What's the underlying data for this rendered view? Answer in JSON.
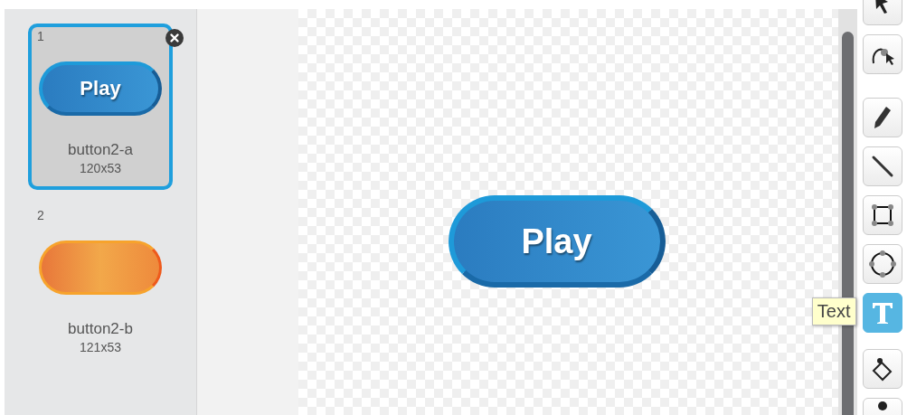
{
  "costumes": [
    {
      "number": "1",
      "name": "button2-a",
      "size": "120x53",
      "selected": true,
      "thumbnail": {
        "kind": "blue",
        "label": "Play"
      }
    },
    {
      "number": "2",
      "name": "button2-b",
      "size": "121x53",
      "selected": false,
      "thumbnail": {
        "kind": "orange"
      }
    }
  ],
  "canvas": {
    "shape": {
      "kind": "blue",
      "label": "Play"
    }
  },
  "tools": [
    {
      "kind": "select",
      "selected": false
    },
    {
      "kind": "reshape",
      "selected": false
    },
    {
      "kind": "pencil",
      "selected": false
    },
    {
      "kind": "line",
      "selected": false
    },
    {
      "kind": "rectangle",
      "selected": false
    },
    {
      "kind": "ellipse",
      "selected": false
    },
    {
      "kind": "text",
      "selected": true,
      "tooltip": "Text"
    },
    {
      "kind": "fill",
      "selected": false
    },
    {
      "kind": "stamp",
      "selected": false
    }
  ]
}
